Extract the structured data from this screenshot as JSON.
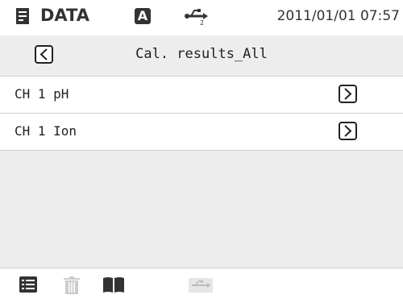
{
  "status_bar": {
    "mode_label": "DATA",
    "auto_badge": "A",
    "datetime": "2011/01/01 07:57",
    "icons": [
      "document-icon",
      "usb-icon"
    ]
  },
  "title_bar": {
    "title": "Cal. results_All",
    "back_icon": "chevron-left-icon"
  },
  "list": {
    "items": [
      {
        "label": "CH 1 pH",
        "icon": "chevron-right-icon"
      },
      {
        "label": "CH 1 Ion",
        "icon": "chevron-right-icon"
      }
    ]
  },
  "toolbar": {
    "icons": [
      "list-icon",
      "trash-icon",
      "book-icon",
      "usb-icon"
    ],
    "colors": {
      "active": "#333333",
      "disabled": "#cccccc"
    }
  }
}
